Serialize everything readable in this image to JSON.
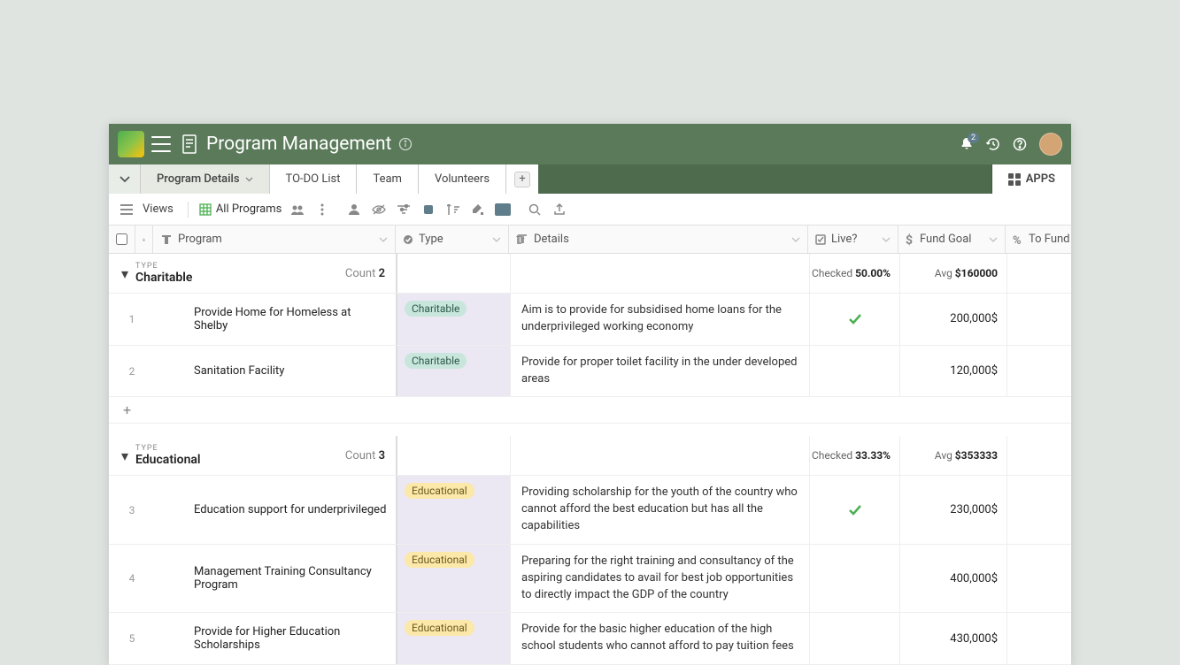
{
  "header": {
    "title": "Program Management",
    "notification_count": "2"
  },
  "tabs": {
    "items": [
      "Program Details",
      "TO-DO List",
      "Team",
      "Volunteers"
    ],
    "apps": "APPS"
  },
  "toolbar": {
    "views": "Views",
    "view_name": "All Programs"
  },
  "columns": {
    "program": "Program",
    "type": "Type",
    "details": "Details",
    "live": "Live?",
    "fund_goal": "Fund Goal",
    "to_fund": "To Fund"
  },
  "groups": [
    {
      "type_label": "TYPE",
      "type_value": "Charitable",
      "count_label": "Count",
      "count": "2",
      "checked_label": "Checked",
      "checked_val": "50.00%",
      "avg_label": "Avg",
      "avg_val": "$160000",
      "badge_class": "char",
      "rows": [
        {
          "num": "1",
          "program": "Provide Home for Homeless at Shelby",
          "type": "Charitable",
          "details": "Aim is to provide for subsidised home loans for the underprivileged working economy",
          "live": true,
          "fund": "200,000$"
        },
        {
          "num": "2",
          "program": "Sanitation Facility",
          "type": "Charitable",
          "details": "Provide for proper toilet facility in the under developed areas",
          "live": false,
          "fund": "120,000$"
        }
      ]
    },
    {
      "type_label": "TYPE",
      "type_value": "Educational",
      "count_label": "Count",
      "count": "3",
      "checked_label": "Checked",
      "checked_val": "33.33%",
      "avg_label": "Avg",
      "avg_val": "$353333",
      "badge_class": "edu",
      "rows": [
        {
          "num": "3",
          "program": "Education support for underprivileged",
          "type": "Educational",
          "details": "Providing scholarship for the youth of the country who cannot afford the best education but has all the capabilities",
          "live": true,
          "fund": "230,000$"
        },
        {
          "num": "4",
          "program": "Management Training Consultancy Program",
          "type": "Educational",
          "details": "Preparing for the right training and consultancy of the aspiring candidates to avail for best job opportunities to directly impact the GDP of the country",
          "live": false,
          "fund": "400,000$"
        },
        {
          "num": "5",
          "program": "Provide for Higher Education Scholarships",
          "type": "Educational",
          "details": "Provide for the basic higher education of the high school students who cannot afford to pay tuition fees",
          "live": false,
          "fund": "430,000$"
        }
      ]
    }
  ]
}
